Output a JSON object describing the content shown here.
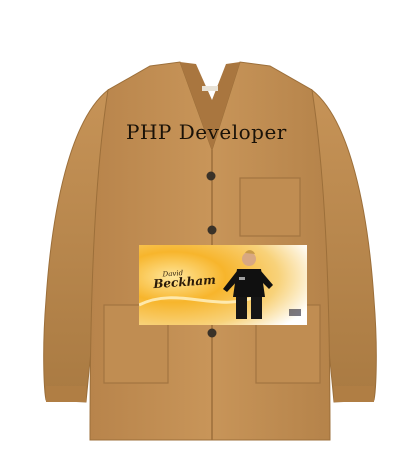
{
  "caption": {
    "text": "PHP Developer"
  },
  "banner": {
    "script_name": "Beckham",
    "small_text": "David"
  },
  "colors": {
    "jacket": "#c49155",
    "jacket_shadow": "#a97a42",
    "jacket_highlight": "#d6a56c",
    "banner_left": "#f5a623",
    "banner_right": "#ffffff",
    "caption": "#1a1208"
  }
}
